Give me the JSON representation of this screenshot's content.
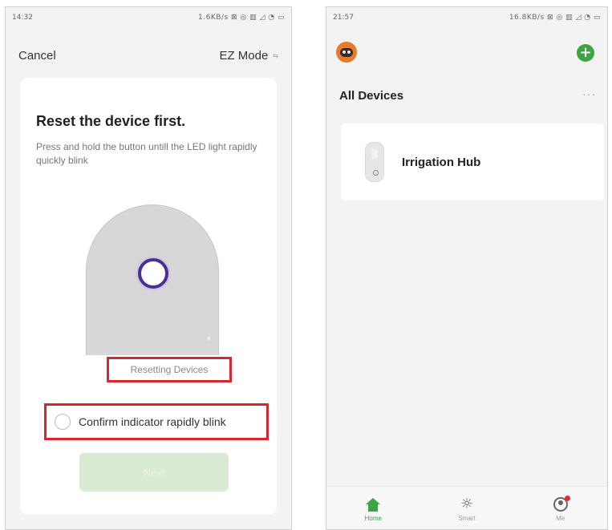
{
  "left_phone": {
    "status_time": "14:32",
    "status_icons": "1.6KB/s ⊠ ◎ ▥ ◿ ◔ ▭",
    "cancel_label": "Cancel",
    "mode_label": "EZ Mode",
    "title": "Reset the device first.",
    "description": "Press and hold the button untill the LED light rapidly quickly blink",
    "resetting_label": "Resetting Devices",
    "confirm_label": "Confirm indicator rapidly blink",
    "next_label": "Next",
    "colors": {
      "highlight_border": "#d9262e",
      "led_ring": "#4b2e93",
      "next_button_bg": "#d9ead2"
    }
  },
  "right_phone": {
    "status_time": "21:57",
    "status_icons": "16.8KB/s ⊠ ◎ ▥ ◿ ◔ ▭",
    "section_title": "All Devices",
    "more_label": "···",
    "devices": [
      {
        "name": "Irrigation Hub",
        "icon": "smart-plug-icon"
      }
    ],
    "tabs": [
      {
        "label": "Home",
        "icon": "home-icon",
        "active": true
      },
      {
        "label": "Smart",
        "icon": "sun-icon",
        "active": false
      },
      {
        "label": "Me",
        "icon": "profile-icon",
        "active": false
      }
    ],
    "colors": {
      "accent": "#3da442",
      "avatar": "#e87a2c",
      "notification_dot": "#e0302f"
    }
  }
}
